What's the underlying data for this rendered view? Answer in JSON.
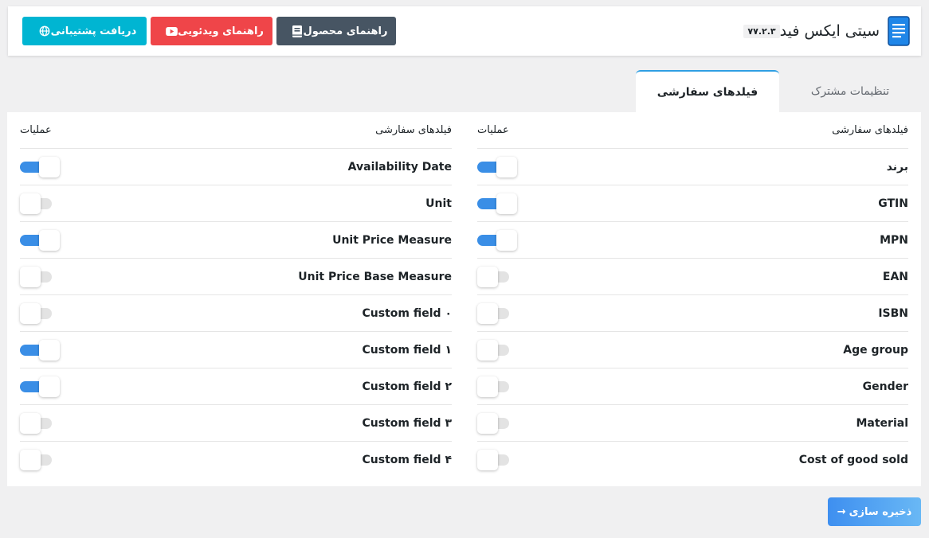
{
  "app": {
    "title": "سیتی ایکس فید",
    "version": "۷۷.۲.۳"
  },
  "header": {
    "buttons": {
      "support": "دریافت پشتیبانی",
      "video": "راهنمای ویدئویی",
      "guide": "راهنمای محصول"
    }
  },
  "tabs": {
    "common": "تنظیمات مشترک",
    "custom": "فیلدهای سفارشی"
  },
  "table": {
    "header_fields": "فیلدهای سفارشی",
    "header_actions": "عملیات",
    "right": [
      {
        "label": "برند",
        "on": true
      },
      {
        "label": "GTIN",
        "on": true
      },
      {
        "label": "MPN",
        "on": true
      },
      {
        "label": "EAN",
        "on": false
      },
      {
        "label": "ISBN",
        "on": false
      },
      {
        "label": "Age group",
        "on": false
      },
      {
        "label": "Gender",
        "on": false
      },
      {
        "label": "Material",
        "on": false
      },
      {
        "label": "Cost of good sold",
        "on": false
      }
    ],
    "left": [
      {
        "label": "Availability Date",
        "on": true
      },
      {
        "label": "Unit",
        "on": false
      },
      {
        "label": "Unit Price Measure",
        "on": true
      },
      {
        "label": "Unit Price Base Measure",
        "on": false
      },
      {
        "label": "Custom field ۰",
        "on": false
      },
      {
        "label": "Custom field ۱",
        "on": true
      },
      {
        "label": "Custom field ۲",
        "on": true
      },
      {
        "label": "Custom field ۳",
        "on": false
      },
      {
        "label": "Custom field ۴",
        "on": false
      }
    ]
  },
  "save": {
    "label": "ذخیره سازی",
    "arrow": "→"
  },
  "colors": {
    "accent": "#3a8ee6",
    "support": "#00b5d2",
    "video": "#ef4549",
    "guide": "#475563"
  }
}
